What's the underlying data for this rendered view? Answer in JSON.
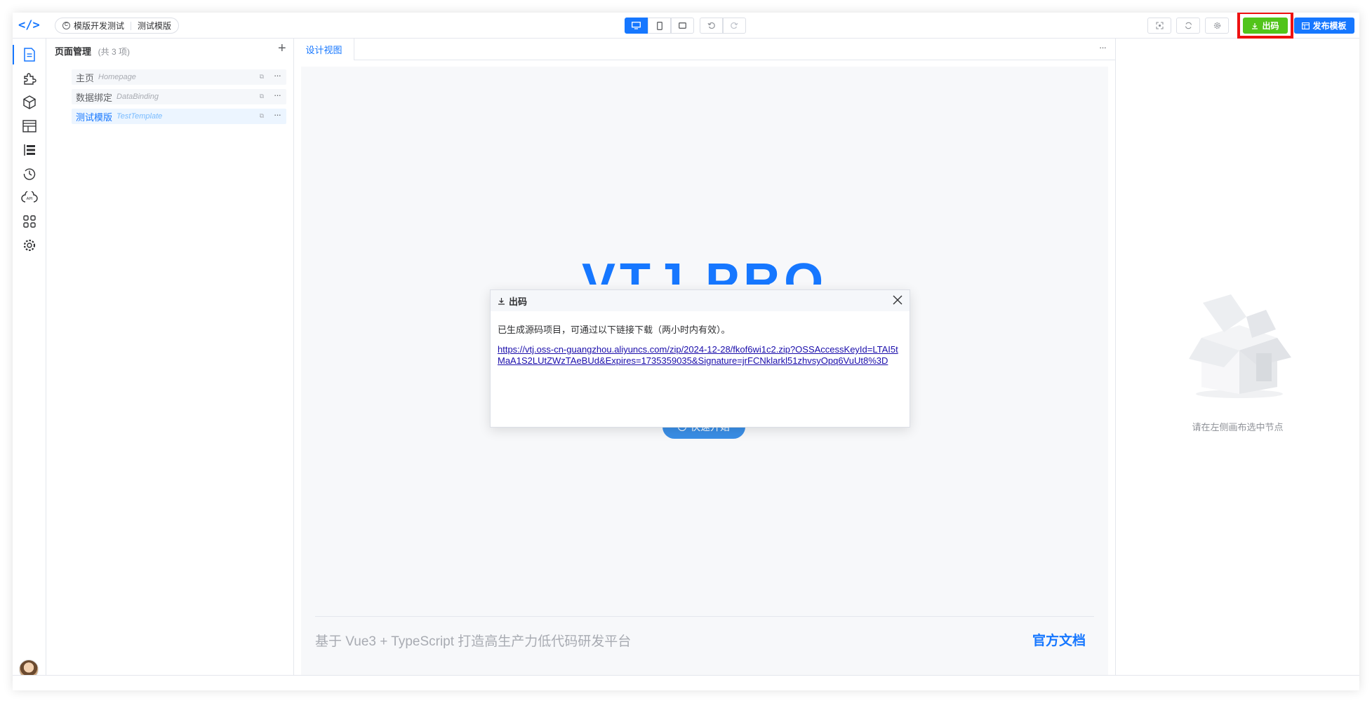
{
  "header": {
    "project_name": "模版开发测试",
    "page_name": "测试模版",
    "export_label": "出码",
    "publish_label": "发布模板"
  },
  "page_panel": {
    "title": "页面管理",
    "count": "(共 3 项)",
    "pages": [
      {
        "name": "主页",
        "en": "Homepage"
      },
      {
        "name": "数据绑定",
        "en": "DataBinding"
      },
      {
        "name": "测试模版",
        "en": "TestTemplate"
      }
    ]
  },
  "design": {
    "tab_label": "设计视图",
    "hero_title": "VTJ.PRO",
    "quick_start_label": "快速开始",
    "footer_text": "基于 Vue3 + TypeScript 打造高生产力低代码研发平台",
    "doc_link": "官方文档"
  },
  "props": {
    "empty_text": "请在左侧画布选中节点"
  },
  "dialog": {
    "title": "出码",
    "message": "已生成源码项目，可通过以下链接下载（两小时内有效）。",
    "link": "https://vtj.oss-cn-guangzhou.aliyuncs.com/zip/2024-12-28/fkof6wi1c2.zip?OSSAccessKeyId=LTAI5tMaA1S2LUtZWzTAeBUd&Expires=1735359035&Signature=jrFCNklarkl51zhvsyOpq6VuUt8%3D"
  },
  "colors": {
    "primary": "#1677ff",
    "export_green": "#52c41a",
    "highlight_red": "#ee1111"
  }
}
